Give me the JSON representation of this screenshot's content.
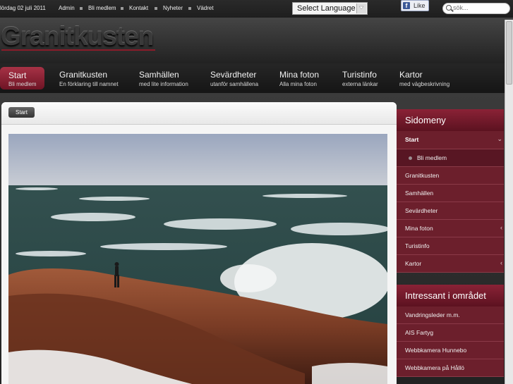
{
  "topbar": {
    "date": "lördag 02 juli 2011",
    "links": [
      "Admin",
      "Bli medlem",
      "Kontakt",
      "Nyheter",
      "Vädret"
    ]
  },
  "language": {
    "label": "Select Language"
  },
  "facebook": {
    "f": "f",
    "like": "Like"
  },
  "search": {
    "placeholder": "sök..."
  },
  "site": {
    "title": "Granitkusten"
  },
  "nav": [
    {
      "main": "Start",
      "sub": "Bli medlem"
    },
    {
      "main": "Granitkusten",
      "sub": "En förklaring till namnet"
    },
    {
      "main": "Samhällen",
      "sub": "med lite information"
    },
    {
      "main": "Sevärdheter",
      "sub": "utanför samhällena"
    },
    {
      "main": "Mina foton",
      "sub": "Alla mina foton"
    },
    {
      "main": "Turistinfo",
      "sub": "externa länkar"
    },
    {
      "main": "Kartor",
      "sub": "med vägbeskrivning"
    }
  ],
  "breadcrumb": {
    "label": "Start"
  },
  "sidebar": {
    "menu_title": "Sidomeny",
    "menu_items": [
      "Start",
      "Bli medlem",
      "Granitkusten",
      "Samhällen",
      "Sevärdheter",
      "Mina foton",
      "Turistinfo",
      "Kartor"
    ],
    "interest_title": "Intressant i området",
    "interest_items": [
      "Vandringsleder m.m.",
      "AIS Fartyg",
      "Webbkamera Hunnebo",
      "Webbkamera på Hållö"
    ]
  },
  "colors": {
    "accent": "#7a1a2c",
    "sidebar": "#6c1f2c",
    "nav_active": "#a73246"
  }
}
